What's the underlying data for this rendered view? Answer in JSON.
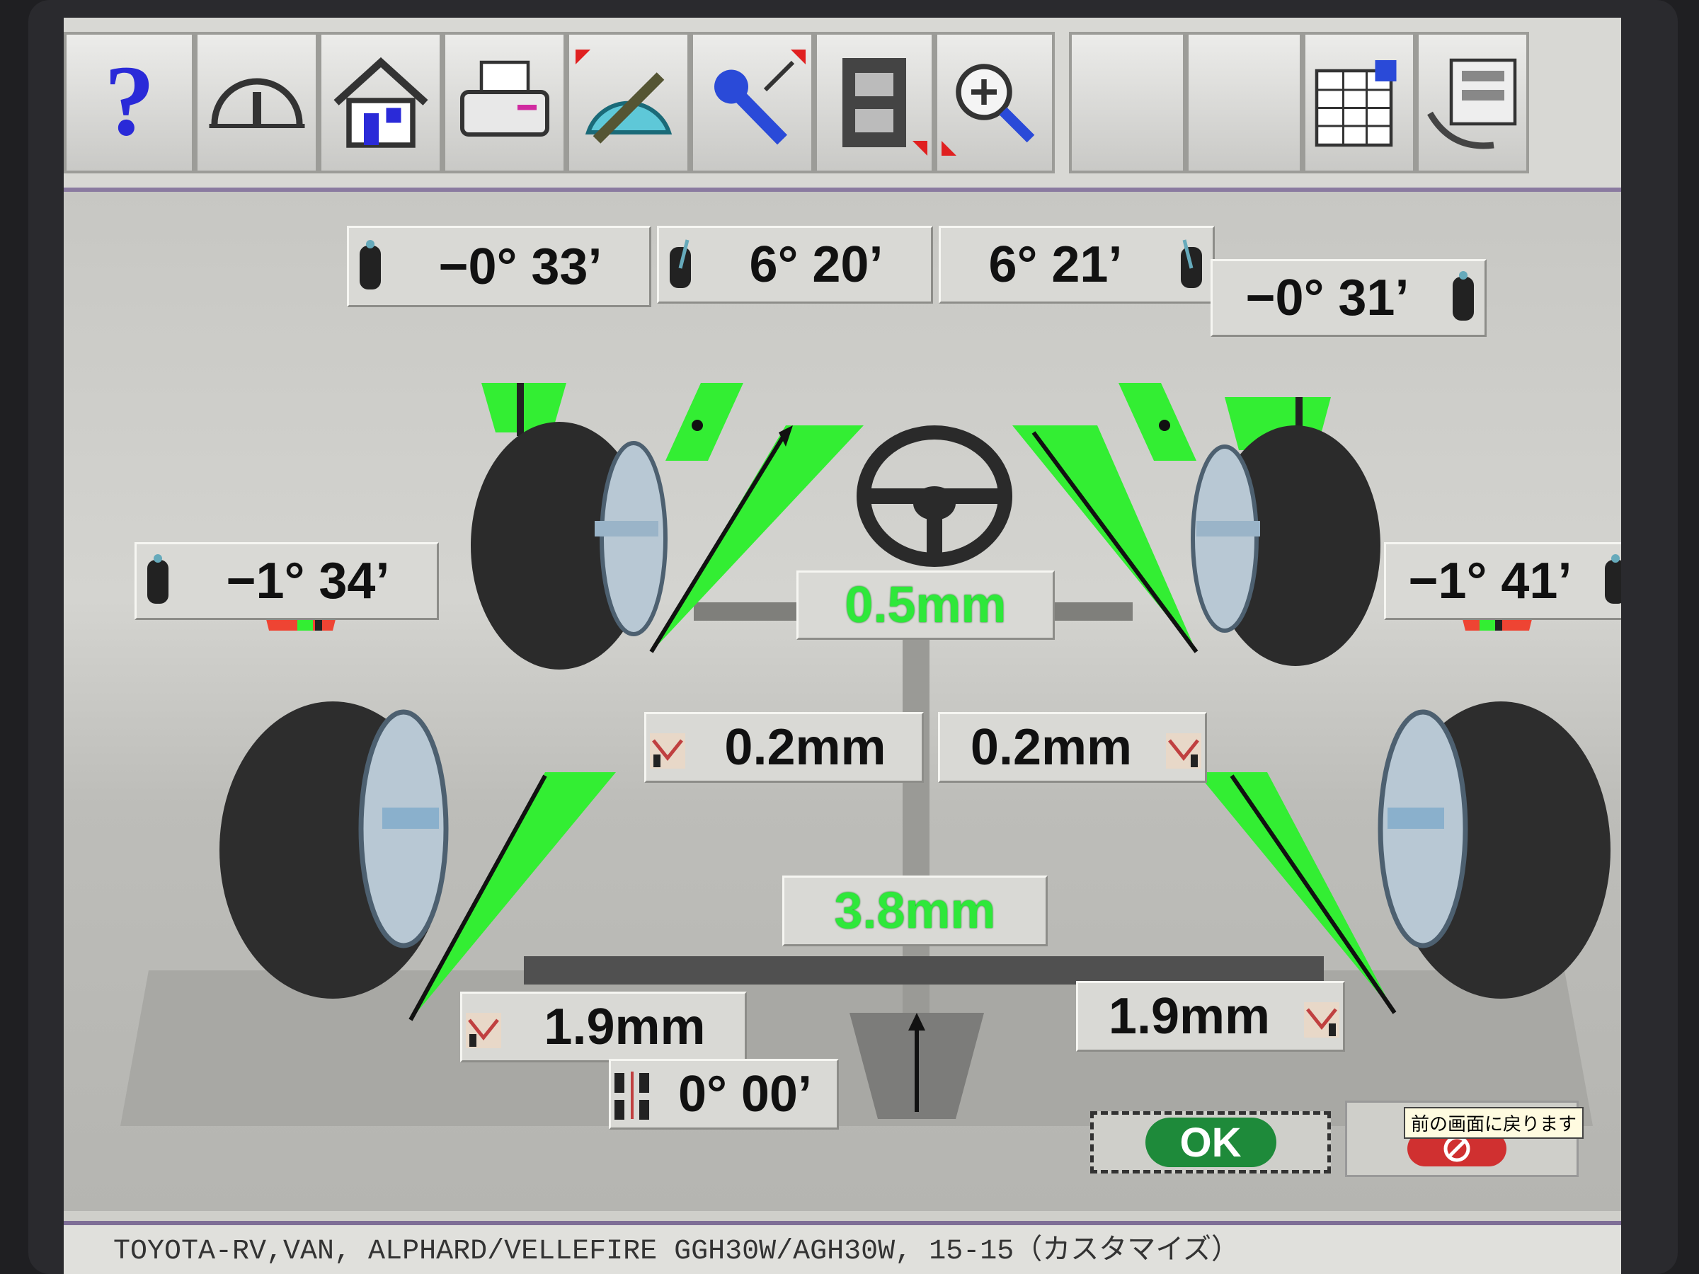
{
  "toolbar": {
    "buttons": [
      {
        "name": "help-icon"
      },
      {
        "name": "gauge-icon"
      },
      {
        "name": "home-icon"
      },
      {
        "name": "printer-icon"
      },
      {
        "name": "adjust-protractor-icon"
      },
      {
        "name": "wrench-icon"
      },
      {
        "name": "film-icon"
      },
      {
        "name": "zoom-icon"
      },
      {
        "name": "blank-icon"
      },
      {
        "name": "blank-icon"
      },
      {
        "name": "spreadsheet-icon"
      },
      {
        "name": "data-sheet-icon"
      }
    ]
  },
  "readings": {
    "front_left_camber": "−0°  33’",
    "front_left_caster": "6°  20’",
    "front_right_caster": "6°  21’",
    "front_right_camber": "−0°  31’",
    "rear_left_camber": "−1°  34’",
    "rear_right_camber": "−1°  41’",
    "front_total_toe": "0.5mm",
    "front_left_toe": "0.2mm",
    "front_right_toe": "0.2mm",
    "rear_total_toe": "3.8mm",
    "rear_left_toe": "1.9mm",
    "rear_right_toe": "1.9mm",
    "thrust_angle": "0°  00’"
  },
  "buttons": {
    "ok_label": "OK",
    "back_tooltip": "前の画面に戻ります"
  },
  "status_bar": "TOYOTA-RV,VAN, ALPHARD/VELLEFIRE GGH30W/AGH30W, 15-15（カスタマイズ）",
  "colors": {
    "in_spec": "#33ee33",
    "out_of_spec": "#ee4433",
    "ok_button": "#1e8a3a"
  }
}
